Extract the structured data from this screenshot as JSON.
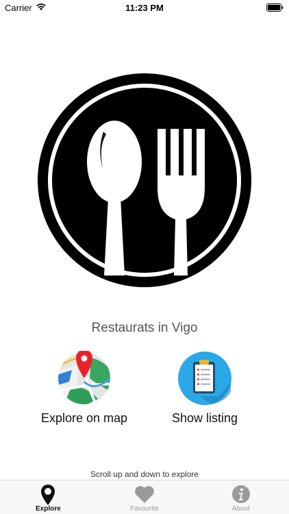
{
  "status_bar": {
    "carrier": "Carrier",
    "time": "11:23 PM",
    "wifi_icon": "wifi-icon",
    "battery_icon": "battery-icon"
  },
  "logo": {
    "icon": "spoon-fork-logo-icon"
  },
  "title": "Restaurats in Vigo",
  "actions": [
    {
      "label": "Explore on map",
      "icon": "map-pin-icon"
    },
    {
      "label": "Show listing",
      "icon": "clipboard-list-icon"
    }
  ],
  "hint": "Scroll up and down to explore",
  "tabs": [
    {
      "label": "Explore",
      "icon": "location-pin-icon",
      "active": true
    },
    {
      "label": "Favourite",
      "icon": "heart-icon",
      "active": false
    },
    {
      "label": "About",
      "icon": "info-icon",
      "active": false
    }
  ],
  "colors": {
    "tab_active": "#111111",
    "tab_inactive": "#9a9a9a",
    "list_icon_bg": "#2aa8e8",
    "map_pin": "#e8222c"
  }
}
